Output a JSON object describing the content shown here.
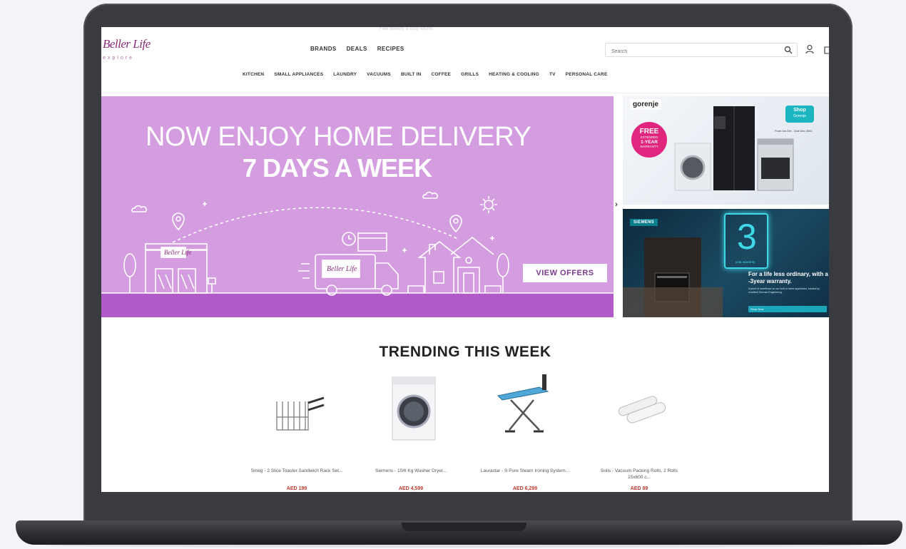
{
  "topbar": {
    "strip_text": "Free delivery & easy returns"
  },
  "brand": {
    "name": "Beller Life",
    "tagline": "explore"
  },
  "main_nav": [
    {
      "label": "BRANDS"
    },
    {
      "label": "DEALS"
    },
    {
      "label": "RECIPES"
    }
  ],
  "search": {
    "placeholder": "Search",
    "value": ""
  },
  "categories": [
    {
      "label": "KITCHEN"
    },
    {
      "label": "SMALL APPLIANCES"
    },
    {
      "label": "LAUNDRY"
    },
    {
      "label": "VACUUMS"
    },
    {
      "label": "BUILT IN"
    },
    {
      "label": "COFFEE"
    },
    {
      "label": "GRILLS"
    },
    {
      "label": "HEATING & COOLING"
    },
    {
      "label": "TV"
    },
    {
      "label": "PERSONAL CARE"
    }
  ],
  "hero": {
    "line1": "NOW ENJOY HOME DELIVERY",
    "line2": "7 DAYS A WEEK",
    "cta": "VIEW OFFERS",
    "truck_label": "Beller Life",
    "store_label": "Beller Life"
  },
  "promo_gorenje": {
    "brand": "gorenje",
    "badge_free": "FREE",
    "badge_ext": "EXTENDED",
    "badge_year": "1-YEAR",
    "badge_warranty": "WARRANTY",
    "shop_line1": "Shop",
    "shop_line2": "Gorenje",
    "dates": "From 1st Oct - 31st Dec 2022"
  },
  "promo_siemens": {
    "brand": "SIEMENS",
    "number": "3",
    "year_label": "year warranty",
    "headline": "For a life less ordinary, with a -3year warranty.",
    "body": "A proof of excellence on our built-in home appliances, backed by excellent German Engineering.",
    "cta": "Shop Now"
  },
  "trending": {
    "title": "TRENDING THIS WEEK",
    "products": [
      {
        "name": "Smeg - 2 Slice Toaster Sandwich Rack Set...",
        "price": "AED 199"
      },
      {
        "name": "Siemens - 10/6 Kg Washer Dryer...",
        "price": "AED 4,599"
      },
      {
        "name": "Laurastar - S Pure Steam Ironing System...",
        "price": "AED 6,299"
      },
      {
        "name": "Solis - Vacuum Packing Rolls, 2 Rolls 15x600 c...",
        "price": "AED 89"
      }
    ]
  }
}
